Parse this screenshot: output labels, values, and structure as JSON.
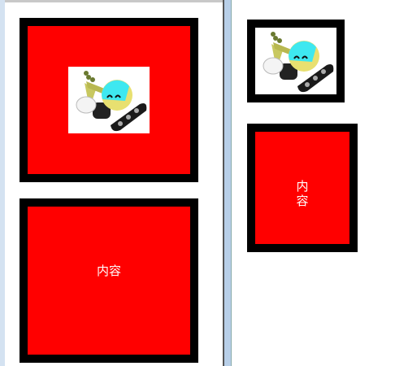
{
  "boxes": {
    "content_label": "内容",
    "content_label_vertical": "内\n容"
  },
  "colors": {
    "box_bg": "#ff0000",
    "border": "#000000",
    "text": "#ffffff"
  },
  "images": {
    "robot": "robot-excavator-icon"
  }
}
